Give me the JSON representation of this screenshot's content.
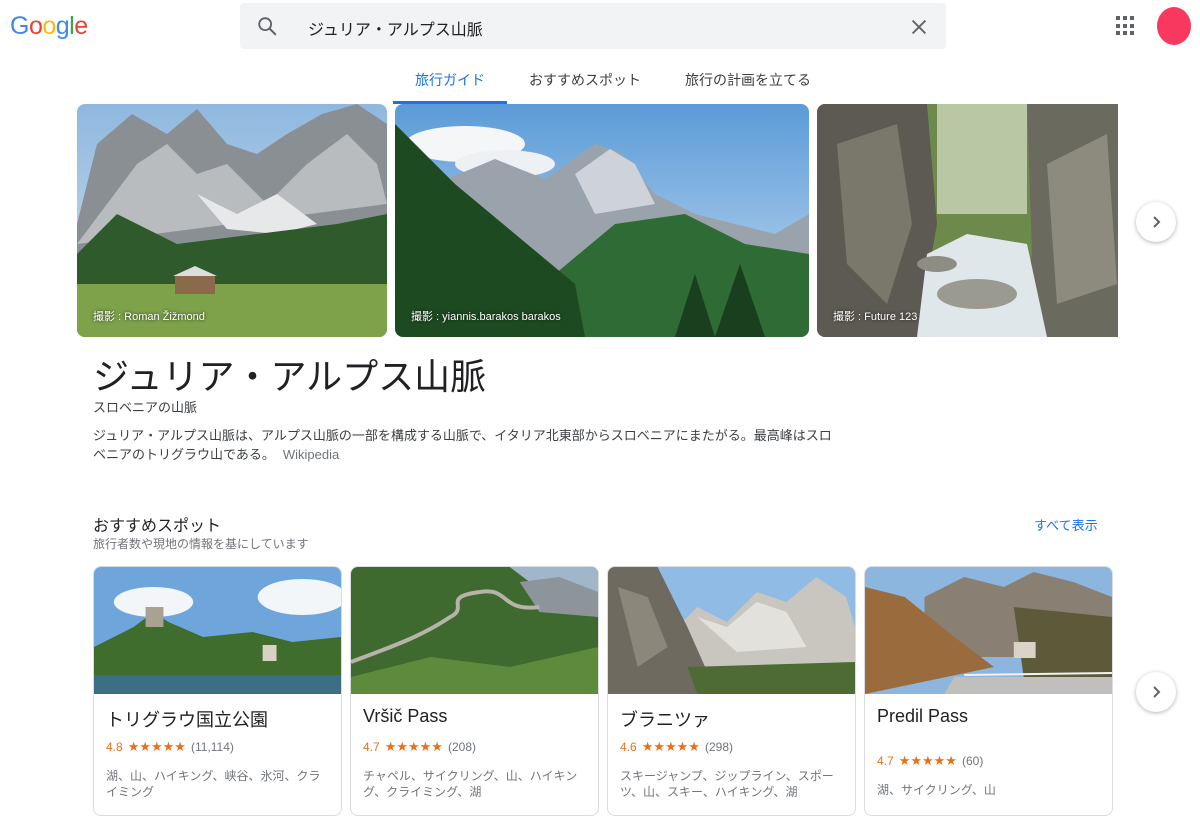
{
  "header": {
    "logo_letters": [
      {
        "ch": "G",
        "color": "#4285f4"
      },
      {
        "ch": "o",
        "color": "#ea4335"
      },
      {
        "ch": "o",
        "color": "#fbbc05"
      },
      {
        "ch": "g",
        "color": "#4285f4"
      },
      {
        "ch": "l",
        "color": "#34a853"
      },
      {
        "ch": "e",
        "color": "#ea4335"
      }
    ],
    "search_query": "ジュリア・アルプス山脈",
    "avatar_color": "#f8385f"
  },
  "tabs": [
    {
      "label": "旅行ガイド",
      "active": true
    },
    {
      "label": "おすすめスポット",
      "active": false
    },
    {
      "label": "旅行の計画を立てる",
      "active": false
    }
  ],
  "hero_photos": [
    {
      "credit": "撮影 : Roman Žižmond"
    },
    {
      "credit": "撮影 : yiannis.barakos barakos"
    },
    {
      "credit": "撮影 : Future 123"
    }
  ],
  "place": {
    "title": "ジュリア・アルプス山脈",
    "subtitle": "スロベニアの山脈",
    "description": "ジュリア・アルプス山脈は、アルプス山脈の一部を構成する山脈で、イタリア北東部からスロベニアにまたがる。最高峰はスロベニアのトリグラウ山である。",
    "source": "Wikipedia"
  },
  "spots": {
    "heading": "おすすめスポット",
    "subheading": "旅行者数や現地の情報を基にしています",
    "see_all": "すべて表示",
    "items": [
      {
        "name": "トリグラウ国立公園",
        "rating": "4.8",
        "stars": "★★★★★",
        "count": "(11,114)",
        "tags": "湖、山、ハイキング、峡谷、氷河、クライミング"
      },
      {
        "name": "Vršič Pass",
        "rating": "4.7",
        "stars": "★★★★★",
        "count": "(208)",
        "tags": "チャペル、サイクリング、山、ハイキング、クライミング、湖"
      },
      {
        "name": "ブラニツァ",
        "rating": "4.6",
        "stars": "★★★★★",
        "count": "(298)",
        "tags": "スキージャンプ、ジップライン、スポーツ、山、スキー、ハイキング、湖"
      },
      {
        "name": "Predil Pass",
        "rating": "4.7",
        "stars": "★★★★★",
        "count": "(60)",
        "tags": "湖、サイクリング、山"
      }
    ]
  }
}
